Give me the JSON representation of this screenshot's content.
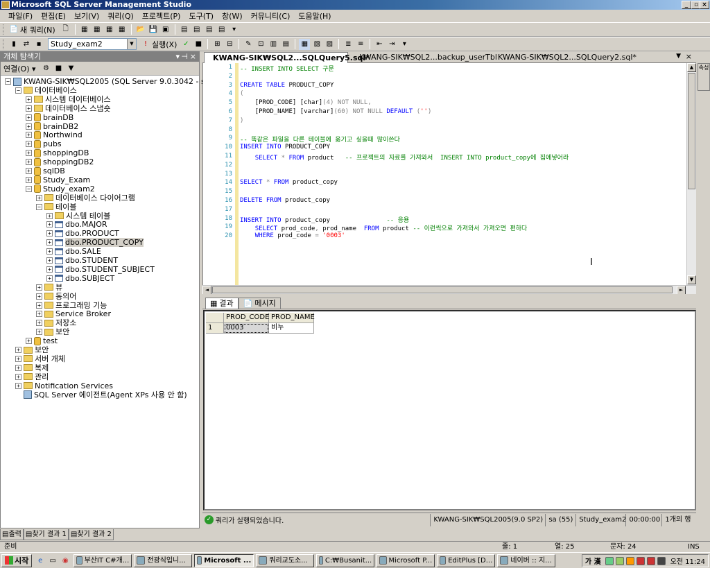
{
  "window": {
    "title": "Microsoft SQL Server Management Studio"
  },
  "menu": [
    "파일(F)",
    "편집(E)",
    "보기(V)",
    "쿼리(Q)",
    "프로젝트(P)",
    "도구(T)",
    "창(W)",
    "커뮤니티(C)",
    "도움말(H)"
  ],
  "toolbar1": {
    "new_query_label": "새 쿼리(N)"
  },
  "toolbar2": {
    "database_combo": "Study_exam2",
    "execute_label": "실행(X)"
  },
  "object_explorer": {
    "title": "개체 탐색기",
    "connect_label": "연결(O) ▾",
    "tree": [
      {
        "label": "KWANG-SIK₩SQL2005 (SQL Server 9.0.3042 - sa)",
        "depth": 0,
        "icon": "server-icon",
        "expander": "−"
      },
      {
        "label": "데이터베이스",
        "depth": 1,
        "icon": "folder-icon",
        "expander": "−"
      },
      {
        "label": "시스템 데이터베이스",
        "depth": 2,
        "icon": "folder-icon",
        "expander": "+"
      },
      {
        "label": "데이터베이스 스냅숏",
        "depth": 2,
        "icon": "folder-icon",
        "expander": "+"
      },
      {
        "label": "brainDB",
        "depth": 2,
        "icon": "database-icon",
        "expander": "+"
      },
      {
        "label": "brainDB2",
        "depth": 2,
        "icon": "database-icon",
        "expander": "+"
      },
      {
        "label": "Northwind",
        "depth": 2,
        "icon": "database-icon",
        "expander": "+"
      },
      {
        "label": "pubs",
        "depth": 2,
        "icon": "database-icon",
        "expander": "+"
      },
      {
        "label": "shoppingDB",
        "depth": 2,
        "icon": "database-icon",
        "expander": "+"
      },
      {
        "label": "shoppingDB2",
        "depth": 2,
        "icon": "database-icon",
        "expander": "+"
      },
      {
        "label": "sqlDB",
        "depth": 2,
        "icon": "database-icon",
        "expander": "+"
      },
      {
        "label": "Study_Exam",
        "depth": 2,
        "icon": "database-icon",
        "expander": "+"
      },
      {
        "label": "Study_exam2",
        "depth": 2,
        "icon": "database-icon",
        "expander": "−"
      },
      {
        "label": "데이터베이스 다이어그램",
        "depth": 3,
        "icon": "folder-icon",
        "expander": "+"
      },
      {
        "label": "테이블",
        "depth": 3,
        "icon": "folder-icon",
        "expander": "−"
      },
      {
        "label": "시스템 테이블",
        "depth": 4,
        "icon": "folder-icon",
        "expander": "+"
      },
      {
        "label": "dbo.MAJOR",
        "depth": 4,
        "icon": "table-icon",
        "expander": "+"
      },
      {
        "label": "dbo.PRODUCT",
        "depth": 4,
        "icon": "table-icon",
        "expander": "+"
      },
      {
        "label": "dbo.PRODUCT_COPY",
        "depth": 4,
        "icon": "table-icon",
        "expander": "+",
        "selected": true
      },
      {
        "label": "dbo.SALE",
        "depth": 4,
        "icon": "table-icon",
        "expander": "+"
      },
      {
        "label": "dbo.STUDENT",
        "depth": 4,
        "icon": "table-icon",
        "expander": "+"
      },
      {
        "label": "dbo.STUDENT_SUBJECT",
        "depth": 4,
        "icon": "table-icon",
        "expander": "+"
      },
      {
        "label": "dbo.SUBJECT",
        "depth": 4,
        "icon": "table-icon",
        "expander": "+"
      },
      {
        "label": "뷰",
        "depth": 3,
        "icon": "folder-icon",
        "expander": "+"
      },
      {
        "label": "동의어",
        "depth": 3,
        "icon": "folder-icon",
        "expander": "+"
      },
      {
        "label": "프로그래밍 기능",
        "depth": 3,
        "icon": "folder-icon",
        "expander": "+"
      },
      {
        "label": "Service Broker",
        "depth": 3,
        "icon": "folder-icon",
        "expander": "+"
      },
      {
        "label": "저장소",
        "depth": 3,
        "icon": "folder-icon",
        "expander": "+"
      },
      {
        "label": "보안",
        "depth": 3,
        "icon": "folder-icon",
        "expander": "+"
      },
      {
        "label": "test",
        "depth": 2,
        "icon": "database-icon",
        "expander": "+"
      },
      {
        "label": "보안",
        "depth": 1,
        "icon": "folder-icon",
        "expander": "+"
      },
      {
        "label": "서버 개체",
        "depth": 1,
        "icon": "folder-icon",
        "expander": "+"
      },
      {
        "label": "복제",
        "depth": 1,
        "icon": "folder-icon",
        "expander": "+"
      },
      {
        "label": "관리",
        "depth": 1,
        "icon": "folder-icon",
        "expander": "+"
      },
      {
        "label": "Notification Services",
        "depth": 1,
        "icon": "folder-icon",
        "expander": "+"
      },
      {
        "label": "SQL Server 에이전트(Agent XPs 사용 안 함)",
        "depth": 1,
        "icon": "agent-icon",
        "expander": ""
      }
    ]
  },
  "editor_tabs": [
    {
      "label": "KWANG-SIK₩SQL2...SQLQuery5.sql*",
      "active": true
    },
    {
      "label": "KWANG-SIK₩SQL2...backup_userTbl",
      "active": false
    },
    {
      "label": "KWANG-SIK₩SQL2...SQLQuery2.sql*",
      "active": false
    }
  ],
  "code_lines": [
    {
      "n": "1",
      "html": "<span class='cm'>-- INSERT INTO SELECT 구문</span>"
    },
    {
      "n": "2",
      "html": ""
    },
    {
      "n": "3",
      "html": "<span class='kw'>CREATE TABLE</span> PRODUCT_COPY"
    },
    {
      "n": "4",
      "html": "<span class='gr'>(</span>"
    },
    {
      "n": "5",
      "html": "    [PROD_CODE] [char]<span class='gr'>(4)</span> <span class='gr'>NOT NULL,</span>"
    },
    {
      "n": "6",
      "html": "    [PROD_NAME] [varchar]<span class='gr'>(60)</span> <span class='gr'>NOT NULL</span> <span class='kw'>DEFAULT</span> <span class='gr'>(</span><span class='st'>''</span><span class='gr'>)</span>"
    },
    {
      "n": "7",
      "html": "<span class='gr'>)</span>"
    },
    {
      "n": "8",
      "html": ""
    },
    {
      "n": "9",
      "html": "<span class='cm'>-- 똑같은 파일을 다른 테이블에 옮기고 싶을때 많이쓴다</span>"
    },
    {
      "n": "10",
      "html": "<span class='kw'>INSERT INTO</span> PRODUCT_COPY"
    },
    {
      "n": "11",
      "html": "    <span class='kw'>SELECT</span> <span class='gr'>*</span> <span class='kw'>FROM</span> product   <span class='cm'>-- 프로젝트의 자료를 가져와서  INSERT INTO product_copy에 집에넣어라</span>"
    },
    {
      "n": "12",
      "html": ""
    },
    {
      "n": "13",
      "html": ""
    },
    {
      "n": "14",
      "html": "<span class='kw'>SELECT</span> <span class='gr'>*</span> <span class='kw'>FROM</span> product_copy"
    },
    {
      "n": "15",
      "html": ""
    },
    {
      "n": "16",
      "html": "<span class='kw'>DELETE FROM</span> product_copy"
    },
    {
      "n": "17",
      "html": ""
    },
    {
      "n": "18",
      "html": "<span class='kw'>INSERT INTO</span> product_copy               <span class='cm'>-- 응용</span>"
    },
    {
      "n": "19",
      "html": "    <span class='kw'>SELECT</span> prod_code<span class='gr'>,</span> prod_name  <span class='kw'>FROM</span> product <span class='cm'>-- 이런씩으로 가져와서 가져오면 편하다</span>"
    },
    {
      "n": "20",
      "html": "    <span class='kw'>WHERE</span> prod_code <span class='gr'>=</span> <span class='st'>'0003'</span>"
    }
  ],
  "results_tabs": [
    "결과",
    "메시지"
  ],
  "results_grid": {
    "columns": [
      "PROD_CODE",
      "PROD_NAME"
    ],
    "rows": [
      {
        "n": "1",
        "cells": [
          "0003",
          "비누"
        ]
      }
    ]
  },
  "query_status": {
    "message": "쿼리가 실행되었습니다.",
    "server": "KWANG-SIK₩SQL2005(9.0 SP2)",
    "user": "sa (55)",
    "database": "Study_exam2",
    "elapsed": "00:00:00",
    "rows": "1개의 행"
  },
  "bottom_tabs": [
    "출력",
    "찾기 결과 1",
    "찾기 결과 2"
  ],
  "statusbar": {
    "ready": "준비",
    "line": "줄: 1",
    "col": "열: 25",
    "ch": "문자: 24",
    "mode": "INS"
  },
  "taskbar": {
    "start": "시작",
    "tasks": [
      {
        "label": "부산IT C#개...",
        "active": false
      },
      {
        "label": "전광식입니...",
        "active": false
      },
      {
        "label": "Microsoft ...",
        "active": true
      },
      {
        "label": "쿼리교도소...",
        "active": false
      },
      {
        "label": "C:₩Busanit...",
        "active": false
      },
      {
        "label": "Microsoft P...",
        "active": false
      },
      {
        "label": "EditPlus [D...",
        "active": false
      },
      {
        "label": "네이버 :: 지...",
        "active": false
      }
    ],
    "ime": "가 漢",
    "clock": "오전 11:24"
  },
  "side_panel": {
    "label": "속성"
  }
}
